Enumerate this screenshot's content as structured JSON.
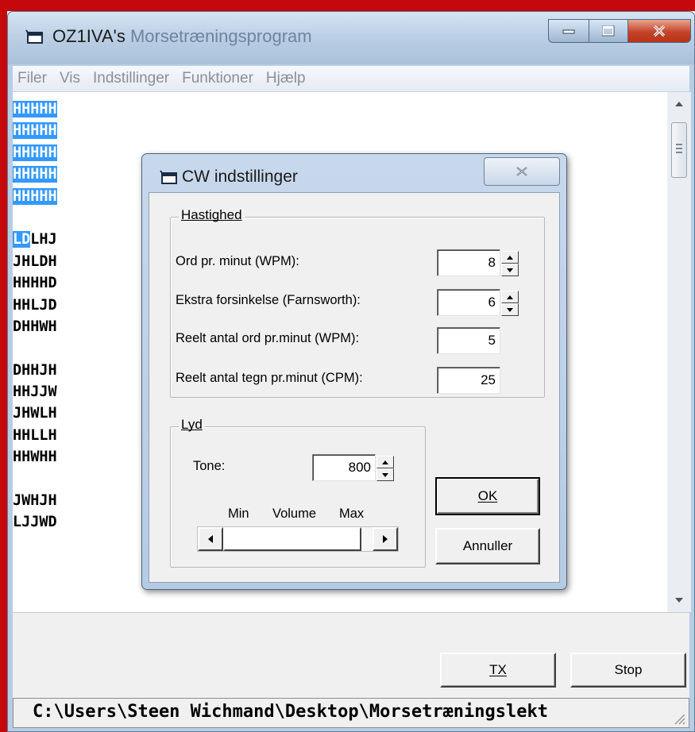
{
  "window": {
    "title_main": "OZ1IVA's",
    "title_rest": " Morsetræningsprogram"
  },
  "menu": [
    "Filer",
    "Vis",
    "Indstillinger",
    "Funktioner",
    "Hjælp"
  ],
  "morse_lines": [
    "HHHHH",
    "HHHHH",
    "HHHHH",
    "HHHHH",
    "HHHHH",
    "",
    "LDLHJ",
    "JHLDH",
    "HHHHD",
    "HHLJD",
    "DHHWH",
    "",
    "DHHJH",
    "HHJJW",
    "JHWLH",
    "HHLLH",
    "HHWHH",
    "",
    "JWHJH",
    "LJJWD"
  ],
  "selection": {
    "full_lines": 5,
    "partial_line_index": 6,
    "partial_chars": 2
  },
  "buttons": {
    "tx": "TX",
    "stop": "Stop"
  },
  "status_path": "C:\\Users\\Steen Wichmand\\Desktop\\Morsetræningslekt",
  "dialog": {
    "title": "CW indstillinger",
    "speed_group": "Hastighed",
    "fields": [
      {
        "label": "Ord pr. minut (WPM):",
        "value": "8",
        "spinner": true
      },
      {
        "label": "Ekstra forsinkelse (Farnsworth):",
        "value": "6",
        "spinner": true
      },
      {
        "label": "Reelt antal ord pr.minut (WPM):",
        "value": "5",
        "spinner": false
      },
      {
        "label": "Reelt antal tegn pr.minut (CPM):",
        "value": "25",
        "spinner": false
      }
    ],
    "sound_group": "Lyd",
    "tone_label": "Tone:",
    "tone_value": "800",
    "volume_labels": {
      "min": "Min",
      "volume": "Volume",
      "max": "Max"
    },
    "volume_level": 1.0,
    "ok": "OK",
    "cancel": "Annuller"
  }
}
